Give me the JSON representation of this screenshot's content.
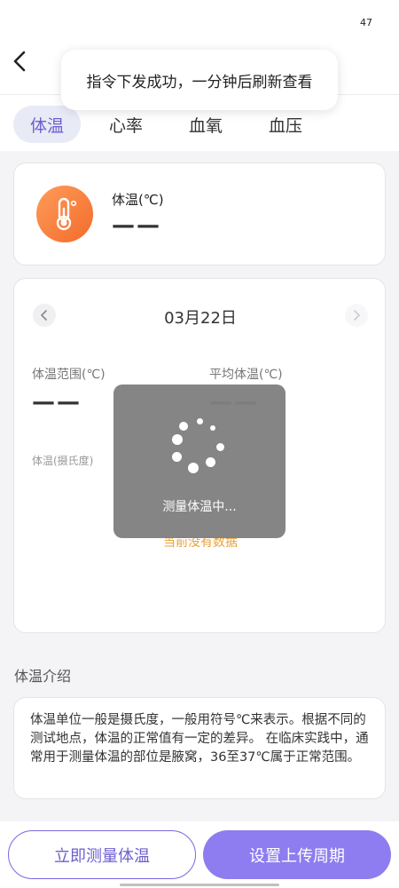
{
  "status": {
    "badge": "47"
  },
  "toast": {
    "message": "指令下发成功，一分钟后刷新查看"
  },
  "tabs": [
    {
      "label": "体温",
      "active": true
    },
    {
      "label": "心率",
      "active": false
    },
    {
      "label": "血氧",
      "active": false
    },
    {
      "label": "血压",
      "active": false
    }
  ],
  "summary": {
    "label": "体温(℃)",
    "value": "——",
    "icon": "thermometer-icon"
  },
  "detail": {
    "date": "03月22日",
    "range_label": "体温范围(℃)",
    "range_value": "——",
    "avg_label": "平均体温(℃)",
    "avg_value": "——",
    "unit_label": "体温(摄氏度)",
    "no_data": "当前没有数据"
  },
  "loading": {
    "text": "测量体温中..."
  },
  "intro": {
    "title": "体温介绍",
    "text": "体温单位一般是摄氏度，一般用符号℃来表示。根据不同的测试地点，体温的正常值有一定的差异。 在临床实践中，通常用于测量体温的部位是腋窝，36至37℃属于正常范围。"
  },
  "actions": {
    "measure_label": "立即测量体温",
    "period_label": "设置上传周期"
  },
  "colors": {
    "accent": "#8d7df0",
    "accent_text": "#6d5fd0",
    "thermo_orange": "#f36b2a",
    "no_data": "#e8a23a"
  }
}
